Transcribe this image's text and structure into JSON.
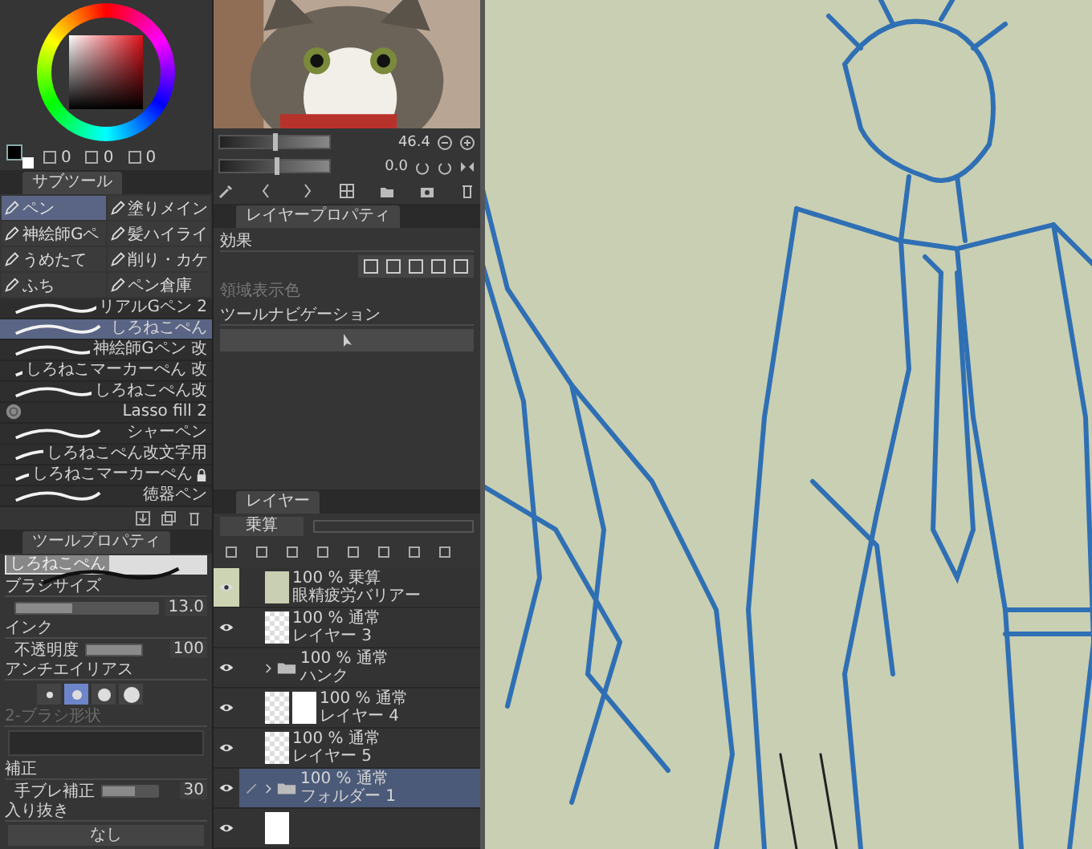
{
  "color": {
    "values": [
      "0",
      "0",
      "0"
    ]
  },
  "subtool": {
    "tab": "サブツール",
    "groups": [
      {
        "label": "ペン",
        "selected": true
      },
      {
        "label": "塗りメイン",
        "selected": false
      },
      {
        "label": "神絵師Gペ",
        "selected": false
      },
      {
        "label": "髪ハイライ",
        "selected": false
      },
      {
        "label": "うめたて",
        "selected": false
      },
      {
        "label": "削り・カケ",
        "selected": false
      },
      {
        "label": "ふち",
        "selected": false
      },
      {
        "label": "ペン倉庫",
        "selected": false
      }
    ],
    "brushes": [
      {
        "name": "リアルGペン 2",
        "kind": "stroke",
        "selected": false,
        "locked": false
      },
      {
        "name": "しろねこぺん",
        "kind": "stroke",
        "selected": true,
        "locked": false
      },
      {
        "name": "神絵師Gペン 改",
        "kind": "stroke",
        "selected": false,
        "locked": false
      },
      {
        "name": "しろねこマーカーぺん 改",
        "kind": "stroke",
        "selected": false,
        "locked": false
      },
      {
        "name": "しろねこぺん改",
        "kind": "stroke",
        "selected": false,
        "locked": false
      },
      {
        "name": "Lasso fill 2",
        "kind": "lasso",
        "selected": false,
        "locked": false
      },
      {
        "name": "シャーペン",
        "kind": "stroke",
        "selected": false,
        "locked": false
      },
      {
        "name": "しろねこぺん改文字用",
        "kind": "stroke",
        "selected": false,
        "locked": false
      },
      {
        "name": "しろねこマーカーぺん",
        "kind": "stroke",
        "selected": false,
        "locked": true
      },
      {
        "name": "徳器ペン",
        "kind": "stroke",
        "selected": false,
        "locked": false
      }
    ]
  },
  "tool_property": {
    "tab": "ツールプロパティ",
    "preview_label": "しろねこぺん",
    "brush_size": {
      "label": "ブラシサイズ",
      "value": "13.0",
      "level": 0.4
    },
    "ink": {
      "label": "インク",
      "sub_label": "不透明度",
      "value": "100",
      "level": 1
    },
    "antialiasing": {
      "label": "アンチエイリアス",
      "options": [
        {
          "selected": false
        },
        {
          "selected": true
        },
        {
          "selected": false
        },
        {
          "selected": false
        }
      ]
    },
    "brush_shape": {
      "label": "2-ブラシ形状",
      "disabled": true
    },
    "correction": {
      "label": "補正",
      "sub_label": "手ブレ補正",
      "value": "30",
      "level": 0.6
    },
    "taper": {
      "label": "入り抜き",
      "value": "なし"
    }
  },
  "navigator": {
    "kind": "picture",
    "zoom": {
      "value": "46.4",
      "level": 0.48
    },
    "rotate": {
      "value": "0.0",
      "level": 0.5
    }
  },
  "layer_property": {
    "tab": "レイヤープロパティ",
    "effect_label": "効果",
    "area_color_label": "領域表示色",
    "tool_nav_label": "ツールナビゲーション"
  },
  "layers": {
    "tab": "レイヤー",
    "blend_mode": "乗算",
    "items": [
      {
        "kind": "color",
        "blend": "100 % 乗算",
        "name": "眼精疲労バリアー",
        "visible": true,
        "selected": false,
        "highlighted": true,
        "editing": false
      },
      {
        "kind": "raster",
        "blend": "100 % 通常",
        "name": "レイヤー 3",
        "visible": true,
        "selected": false,
        "highlighted": false,
        "editing": false
      },
      {
        "kind": "folder",
        "blend": "100 % 通常",
        "name": "ハンク",
        "visible": true,
        "selected": false,
        "highlighted": false,
        "editing": false
      },
      {
        "kind": "masked",
        "blend": "100 % 通常",
        "name": "レイヤー 4",
        "visible": true,
        "selected": false,
        "highlighted": false,
        "editing": false
      },
      {
        "kind": "raster",
        "blend": "100 % 通常",
        "name": "レイヤー 5",
        "visible": true,
        "selected": false,
        "highlighted": false,
        "editing": false
      },
      {
        "kind": "folder",
        "blend": "100 % 通常",
        "name": "フォルダー 1",
        "visible": true,
        "selected": true,
        "highlighted": false,
        "editing": true
      }
    ]
  }
}
